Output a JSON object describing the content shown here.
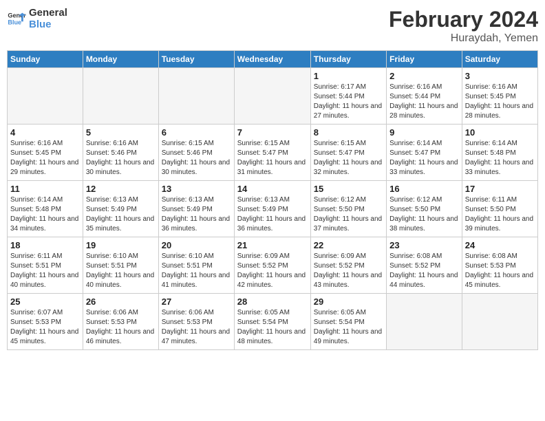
{
  "header": {
    "logo_general": "General",
    "logo_blue": "Blue",
    "month_title": "February 2024",
    "location": "Huraydah, Yemen"
  },
  "weekdays": [
    "Sunday",
    "Monday",
    "Tuesday",
    "Wednesday",
    "Thursday",
    "Friday",
    "Saturday"
  ],
  "weeks": [
    [
      {
        "day": "",
        "info": ""
      },
      {
        "day": "",
        "info": ""
      },
      {
        "day": "",
        "info": ""
      },
      {
        "day": "",
        "info": ""
      },
      {
        "day": "1",
        "info": "Sunrise: 6:17 AM\nSunset: 5:44 PM\nDaylight: 11 hours\nand 27 minutes."
      },
      {
        "day": "2",
        "info": "Sunrise: 6:16 AM\nSunset: 5:44 PM\nDaylight: 11 hours\nand 28 minutes."
      },
      {
        "day": "3",
        "info": "Sunrise: 6:16 AM\nSunset: 5:45 PM\nDaylight: 11 hours\nand 28 minutes."
      }
    ],
    [
      {
        "day": "4",
        "info": "Sunrise: 6:16 AM\nSunset: 5:45 PM\nDaylight: 11 hours\nand 29 minutes."
      },
      {
        "day": "5",
        "info": "Sunrise: 6:16 AM\nSunset: 5:46 PM\nDaylight: 11 hours\nand 30 minutes."
      },
      {
        "day": "6",
        "info": "Sunrise: 6:15 AM\nSunset: 5:46 PM\nDaylight: 11 hours\nand 30 minutes."
      },
      {
        "day": "7",
        "info": "Sunrise: 6:15 AM\nSunset: 5:47 PM\nDaylight: 11 hours\nand 31 minutes."
      },
      {
        "day": "8",
        "info": "Sunrise: 6:15 AM\nSunset: 5:47 PM\nDaylight: 11 hours\nand 32 minutes."
      },
      {
        "day": "9",
        "info": "Sunrise: 6:14 AM\nSunset: 5:47 PM\nDaylight: 11 hours\nand 33 minutes."
      },
      {
        "day": "10",
        "info": "Sunrise: 6:14 AM\nSunset: 5:48 PM\nDaylight: 11 hours\nand 33 minutes."
      }
    ],
    [
      {
        "day": "11",
        "info": "Sunrise: 6:14 AM\nSunset: 5:48 PM\nDaylight: 11 hours\nand 34 minutes."
      },
      {
        "day": "12",
        "info": "Sunrise: 6:13 AM\nSunset: 5:49 PM\nDaylight: 11 hours\nand 35 minutes."
      },
      {
        "day": "13",
        "info": "Sunrise: 6:13 AM\nSunset: 5:49 PM\nDaylight: 11 hours\nand 36 minutes."
      },
      {
        "day": "14",
        "info": "Sunrise: 6:13 AM\nSunset: 5:49 PM\nDaylight: 11 hours\nand 36 minutes."
      },
      {
        "day": "15",
        "info": "Sunrise: 6:12 AM\nSunset: 5:50 PM\nDaylight: 11 hours\nand 37 minutes."
      },
      {
        "day": "16",
        "info": "Sunrise: 6:12 AM\nSunset: 5:50 PM\nDaylight: 11 hours\nand 38 minutes."
      },
      {
        "day": "17",
        "info": "Sunrise: 6:11 AM\nSunset: 5:50 PM\nDaylight: 11 hours\nand 39 minutes."
      }
    ],
    [
      {
        "day": "18",
        "info": "Sunrise: 6:11 AM\nSunset: 5:51 PM\nDaylight: 11 hours\nand 40 minutes."
      },
      {
        "day": "19",
        "info": "Sunrise: 6:10 AM\nSunset: 5:51 PM\nDaylight: 11 hours\nand 40 minutes."
      },
      {
        "day": "20",
        "info": "Sunrise: 6:10 AM\nSunset: 5:51 PM\nDaylight: 11 hours\nand 41 minutes."
      },
      {
        "day": "21",
        "info": "Sunrise: 6:09 AM\nSunset: 5:52 PM\nDaylight: 11 hours\nand 42 minutes."
      },
      {
        "day": "22",
        "info": "Sunrise: 6:09 AM\nSunset: 5:52 PM\nDaylight: 11 hours\nand 43 minutes."
      },
      {
        "day": "23",
        "info": "Sunrise: 6:08 AM\nSunset: 5:52 PM\nDaylight: 11 hours\nand 44 minutes."
      },
      {
        "day": "24",
        "info": "Sunrise: 6:08 AM\nSunset: 5:53 PM\nDaylight: 11 hours\nand 45 minutes."
      }
    ],
    [
      {
        "day": "25",
        "info": "Sunrise: 6:07 AM\nSunset: 5:53 PM\nDaylight: 11 hours\nand 45 minutes."
      },
      {
        "day": "26",
        "info": "Sunrise: 6:06 AM\nSunset: 5:53 PM\nDaylight: 11 hours\nand 46 minutes."
      },
      {
        "day": "27",
        "info": "Sunrise: 6:06 AM\nSunset: 5:53 PM\nDaylight: 11 hours\nand 47 minutes."
      },
      {
        "day": "28",
        "info": "Sunrise: 6:05 AM\nSunset: 5:54 PM\nDaylight: 11 hours\nand 48 minutes."
      },
      {
        "day": "29",
        "info": "Sunrise: 6:05 AM\nSunset: 5:54 PM\nDaylight: 11 hours\nand 49 minutes."
      },
      {
        "day": "",
        "info": ""
      },
      {
        "day": "",
        "info": ""
      }
    ]
  ]
}
